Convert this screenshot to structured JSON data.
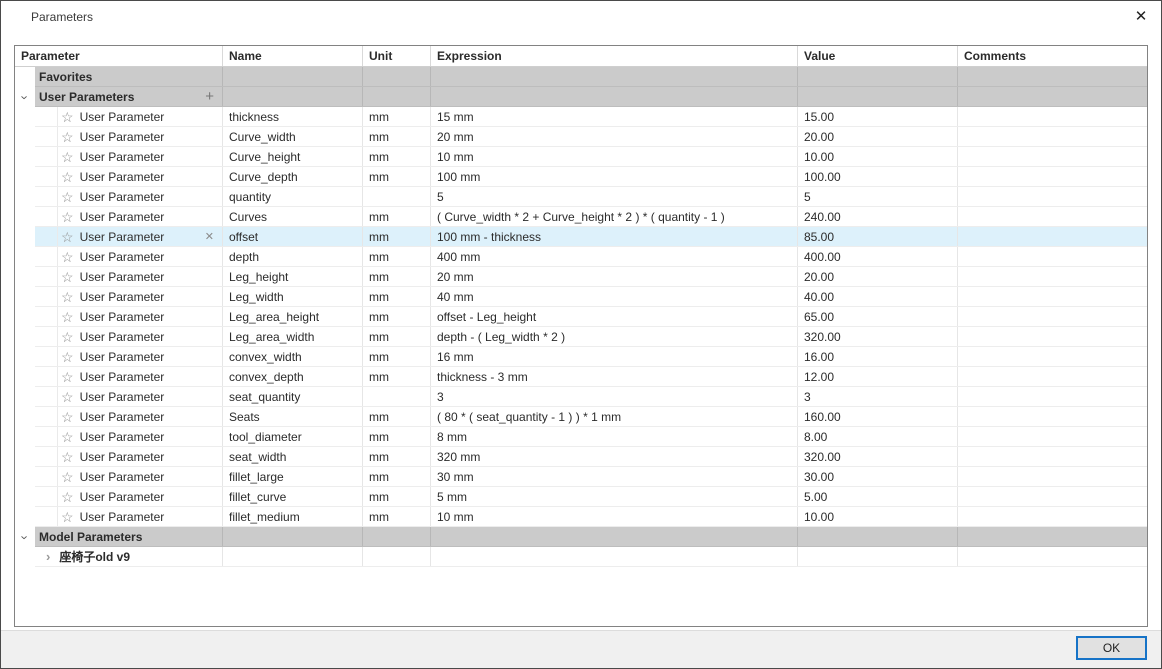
{
  "dialog": {
    "title": "Parameters",
    "ok_label": "OK"
  },
  "icons": {
    "close": "✕",
    "star": "☆",
    "chevron": "›",
    "plus": "+",
    "delete": "✕"
  },
  "colors": {
    "selected_row_bg": "#ddf1fb",
    "section_row_bg": "#cbcbcb",
    "footer_bg": "#f0f0f0",
    "ok_button_border": "#1673c7",
    "table_border": "#828282"
  },
  "table": {
    "columns": [
      "Parameter",
      "Name",
      "Unit",
      "Expression",
      "Value",
      "Comments"
    ],
    "rows": [
      {
        "kind": "section",
        "label": "Favorites",
        "chevron": null,
        "plus": false
      },
      {
        "kind": "section",
        "label": "User Parameters",
        "chevron": "down",
        "plus": true
      },
      {
        "kind": "param",
        "parameter": "User Parameter",
        "name": "thickness",
        "unit": "mm",
        "expression": "15 mm",
        "value": "15.00",
        "comments": "",
        "selected": false,
        "deletable": false
      },
      {
        "kind": "param",
        "parameter": "User Parameter",
        "name": "Curve_width",
        "unit": "mm",
        "expression": "20 mm",
        "value": "20.00",
        "comments": "",
        "selected": false,
        "deletable": false
      },
      {
        "kind": "param",
        "parameter": "User Parameter",
        "name": "Curve_height",
        "unit": "mm",
        "expression": "10 mm",
        "value": "10.00",
        "comments": "",
        "selected": false,
        "deletable": false
      },
      {
        "kind": "param",
        "parameter": "User Parameter",
        "name": "Curve_depth",
        "unit": "mm",
        "expression": "100 mm",
        "value": "100.00",
        "comments": "",
        "selected": false,
        "deletable": false
      },
      {
        "kind": "param",
        "parameter": "User Parameter",
        "name": "quantity",
        "unit": "",
        "expression": "5",
        "value": "5",
        "comments": "",
        "selected": false,
        "deletable": false
      },
      {
        "kind": "param",
        "parameter": "User Parameter",
        "name": "Curves",
        "unit": "mm",
        "expression": "( Curve_width * 2 + Curve_height * 2 ) * ( quantity - 1 )",
        "value": "240.00",
        "comments": "",
        "selected": false,
        "deletable": false
      },
      {
        "kind": "param",
        "parameter": "User Parameter",
        "name": "offset",
        "unit": "mm",
        "expression": "100 mm - thickness",
        "value": "85.00",
        "comments": "",
        "selected": true,
        "deletable": true
      },
      {
        "kind": "param",
        "parameter": "User Parameter",
        "name": "depth",
        "unit": "mm",
        "expression": "400 mm",
        "value": "400.00",
        "comments": "",
        "selected": false,
        "deletable": false
      },
      {
        "kind": "param",
        "parameter": "User Parameter",
        "name": "Leg_height",
        "unit": "mm",
        "expression": "20 mm",
        "value": "20.00",
        "comments": "",
        "selected": false,
        "deletable": false
      },
      {
        "kind": "param",
        "parameter": "User Parameter",
        "name": "Leg_width",
        "unit": "mm",
        "expression": "40 mm",
        "value": "40.00",
        "comments": "",
        "selected": false,
        "deletable": false
      },
      {
        "kind": "param",
        "parameter": "User Parameter",
        "name": "Leg_area_height",
        "unit": "mm",
        "expression": "offset - Leg_height",
        "value": "65.00",
        "comments": "",
        "selected": false,
        "deletable": false
      },
      {
        "kind": "param",
        "parameter": "User Parameter",
        "name": "Leg_area_width",
        "unit": "mm",
        "expression": "depth - ( Leg_width * 2 )",
        "value": "320.00",
        "comments": "",
        "selected": false,
        "deletable": false
      },
      {
        "kind": "param",
        "parameter": "User Parameter",
        "name": "convex_width",
        "unit": "mm",
        "expression": "16 mm",
        "value": "16.00",
        "comments": "",
        "selected": false,
        "deletable": false
      },
      {
        "kind": "param",
        "parameter": "User Parameter",
        "name": "convex_depth",
        "unit": "mm",
        "expression": "thickness - 3 mm",
        "value": "12.00",
        "comments": "",
        "selected": false,
        "deletable": false
      },
      {
        "kind": "param",
        "parameter": "User Parameter",
        "name": "seat_quantity",
        "unit": "",
        "expression": "3",
        "value": "3",
        "comments": "",
        "selected": false,
        "deletable": false
      },
      {
        "kind": "param",
        "parameter": "User Parameter",
        "name": "Seats",
        "unit": "mm",
        "expression": "( 80 * ( seat_quantity - 1 ) ) * 1 mm",
        "value": "160.00",
        "comments": "",
        "selected": false,
        "deletable": false
      },
      {
        "kind": "param",
        "parameter": "User Parameter",
        "name": "tool_diameter",
        "unit": "mm",
        "expression": "8 mm",
        "value": "8.00",
        "comments": "",
        "selected": false,
        "deletable": false
      },
      {
        "kind": "param",
        "parameter": "User Parameter",
        "name": "seat_width",
        "unit": "mm",
        "expression": "320 mm",
        "value": "320.00",
        "comments": "",
        "selected": false,
        "deletable": false
      },
      {
        "kind": "param",
        "parameter": "User Parameter",
        "name": "fillet_large",
        "unit": "mm",
        "expression": "30 mm",
        "value": "30.00",
        "comments": "",
        "selected": false,
        "deletable": false
      },
      {
        "kind": "param",
        "parameter": "User Parameter",
        "name": "fillet_curve",
        "unit": "mm",
        "expression": "5 mm",
        "value": "5.00",
        "comments": "",
        "selected": false,
        "deletable": false
      },
      {
        "kind": "param",
        "parameter": "User Parameter",
        "name": "fillet_medium",
        "unit": "mm",
        "expression": "10 mm",
        "value": "10.00",
        "comments": "",
        "selected": false,
        "deletable": false
      },
      {
        "kind": "section",
        "label": "Model Parameters",
        "chevron": "down",
        "plus": false
      },
      {
        "kind": "model",
        "label": "座椅子old v9",
        "chevron": "right"
      }
    ]
  }
}
